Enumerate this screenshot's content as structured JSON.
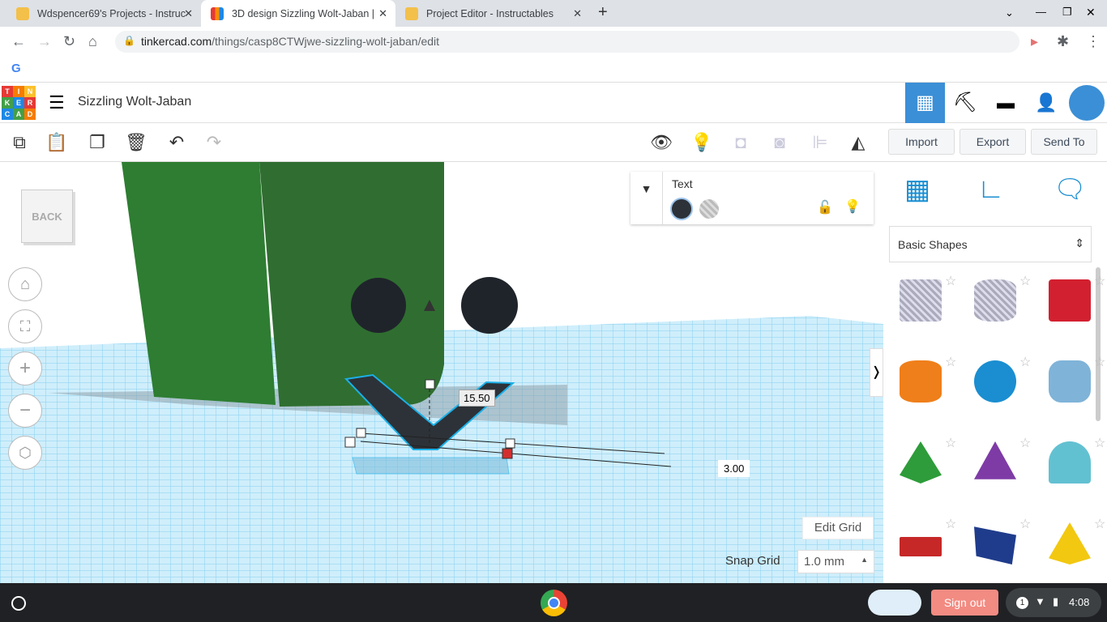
{
  "browser": {
    "tabs": [
      {
        "title": "Wdspencer69's Projects - Instruc",
        "active": false
      },
      {
        "title": "3D design Sizzling Wolt-Jaban |",
        "active": true
      },
      {
        "title": "Project Editor - Instructables",
        "active": false
      }
    ],
    "url_host": "tinkercad.com",
    "url_path": "/things/casp8CTWjwe-sizzling-wolt-jaban/edit",
    "bookmark": "G"
  },
  "app": {
    "logo": [
      "TIN",
      "KER",
      "CAD"
    ],
    "design_title": "Sizzling Wolt-Jaban",
    "buttons": {
      "import": "Import",
      "export": "Export",
      "send_to": "Send To"
    },
    "colors": {
      "accent": "#1a8ed1",
      "grid": "#6cc3ea",
      "green": "#2e7d32",
      "header_active": "#3b8fd6"
    }
  },
  "viewcube": {
    "label": "BACK"
  },
  "inspector": {
    "title": "Text",
    "solid_selected": true
  },
  "viewport": {
    "dim_width": "15.50",
    "dim_height": "3.00",
    "edit_grid": "Edit Grid",
    "snap_grid_label": "Snap Grid",
    "snap_grid_value": "1.0 mm"
  },
  "sidebar": {
    "category": "Basic Shapes",
    "shapes": [
      "Box Hole",
      "Cylinder Hole",
      "Box",
      "Cylinder",
      "Sphere",
      "Scribble",
      "Roof",
      "Cone",
      "Round Roof",
      "Text",
      "Half Sphere",
      "Pyramid"
    ]
  },
  "taskbar": {
    "sign_out": "Sign out",
    "notif_count": "1",
    "time": "4:08"
  }
}
